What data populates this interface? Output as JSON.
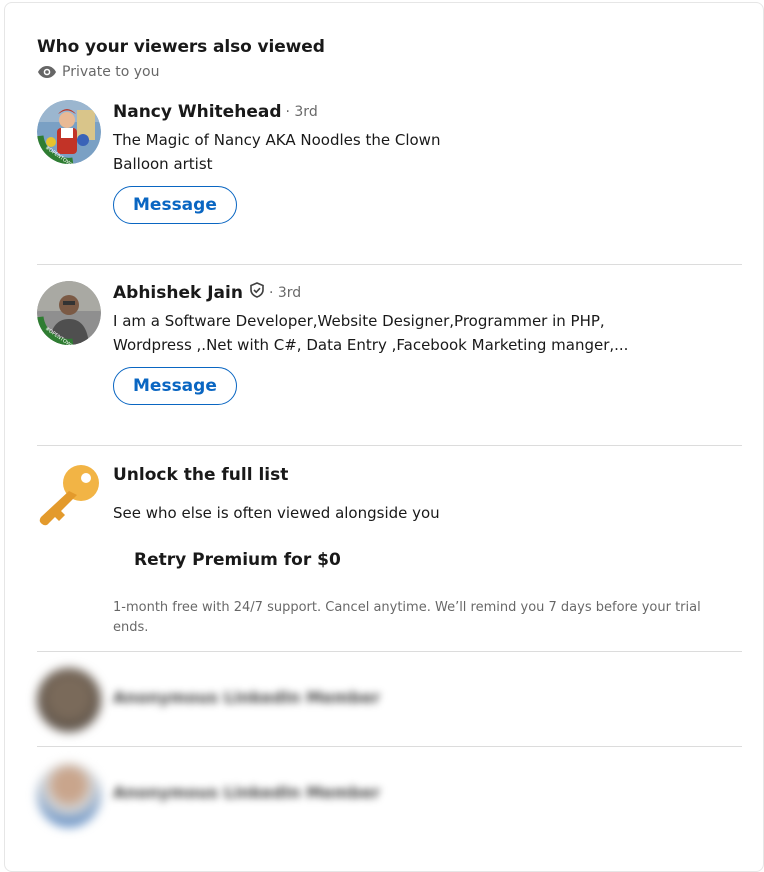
{
  "section": {
    "title": "Who your viewers also viewed",
    "privacy_label": "Private to you",
    "privacy_icon": "eye-icon"
  },
  "people": [
    {
      "name": "Nancy Whitehead",
      "degree": "· 3rd",
      "headline_line1": "The Magic of Nancy AKA Noodles the Clown",
      "headline_line2": "Balloon artist",
      "button_label": "Message",
      "verified": false,
      "open_to_work": true
    },
    {
      "name": "Abhishek Jain",
      "degree": "· 3rd",
      "headline_line1": "I am a Software Developer,Website Designer,Programmer in PHP,",
      "headline_line2": "Wordpress ,.Net with C#, Data Entry ,Facebook Marketing manger,...",
      "button_label": "Message",
      "verified": true,
      "open_to_work": true
    }
  ],
  "upsell": {
    "icon": "key-icon",
    "title": "Unlock the full list",
    "description": "See who else is often viewed alongside you",
    "button_label": "Retry Premium for $0",
    "fine_print": "1-month free with 24/7 support. Cancel anytime. We’ll remind you 7 days before your trial ends."
  },
  "anonymous": [
    {
      "label": "Anonymous LinkedIn Member"
    },
    {
      "label": "Anonymous LinkedIn Member"
    }
  ],
  "colors": {
    "brand_blue": "#0a66c2",
    "key_gold": "#e8a23c",
    "open_to_work_green": "#2f7d32"
  }
}
